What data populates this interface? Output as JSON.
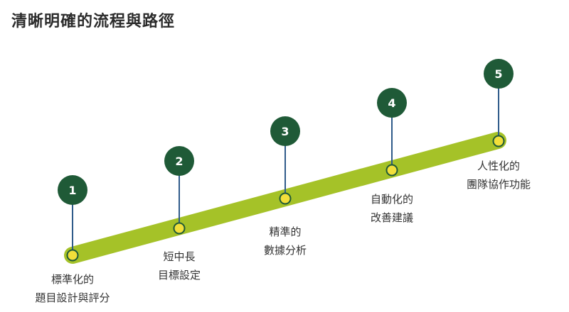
{
  "title": "清晰明確的流程與路徑",
  "colors": {
    "track": "#A5C228",
    "node_fill": "#F2DF3A",
    "node_stroke": "#1F5A37",
    "badge": "#1F5A37",
    "connector": "#2F5B8A",
    "badge_text": "#FFFFFF"
  },
  "steps": [
    {
      "number": "1",
      "label_line1": "標準化的",
      "label_line2": "題目設計與評分"
    },
    {
      "number": "2",
      "label_line1": "短中長",
      "label_line2": "目標設定"
    },
    {
      "number": "3",
      "label_line1": "精準的",
      "label_line2": "數據分析"
    },
    {
      "number": "4",
      "label_line1": "自動化的",
      "label_line2": "改善建議"
    },
    {
      "number": "5",
      "label_line1": "人性化的",
      "label_line2": "團隊協作功能"
    }
  ]
}
